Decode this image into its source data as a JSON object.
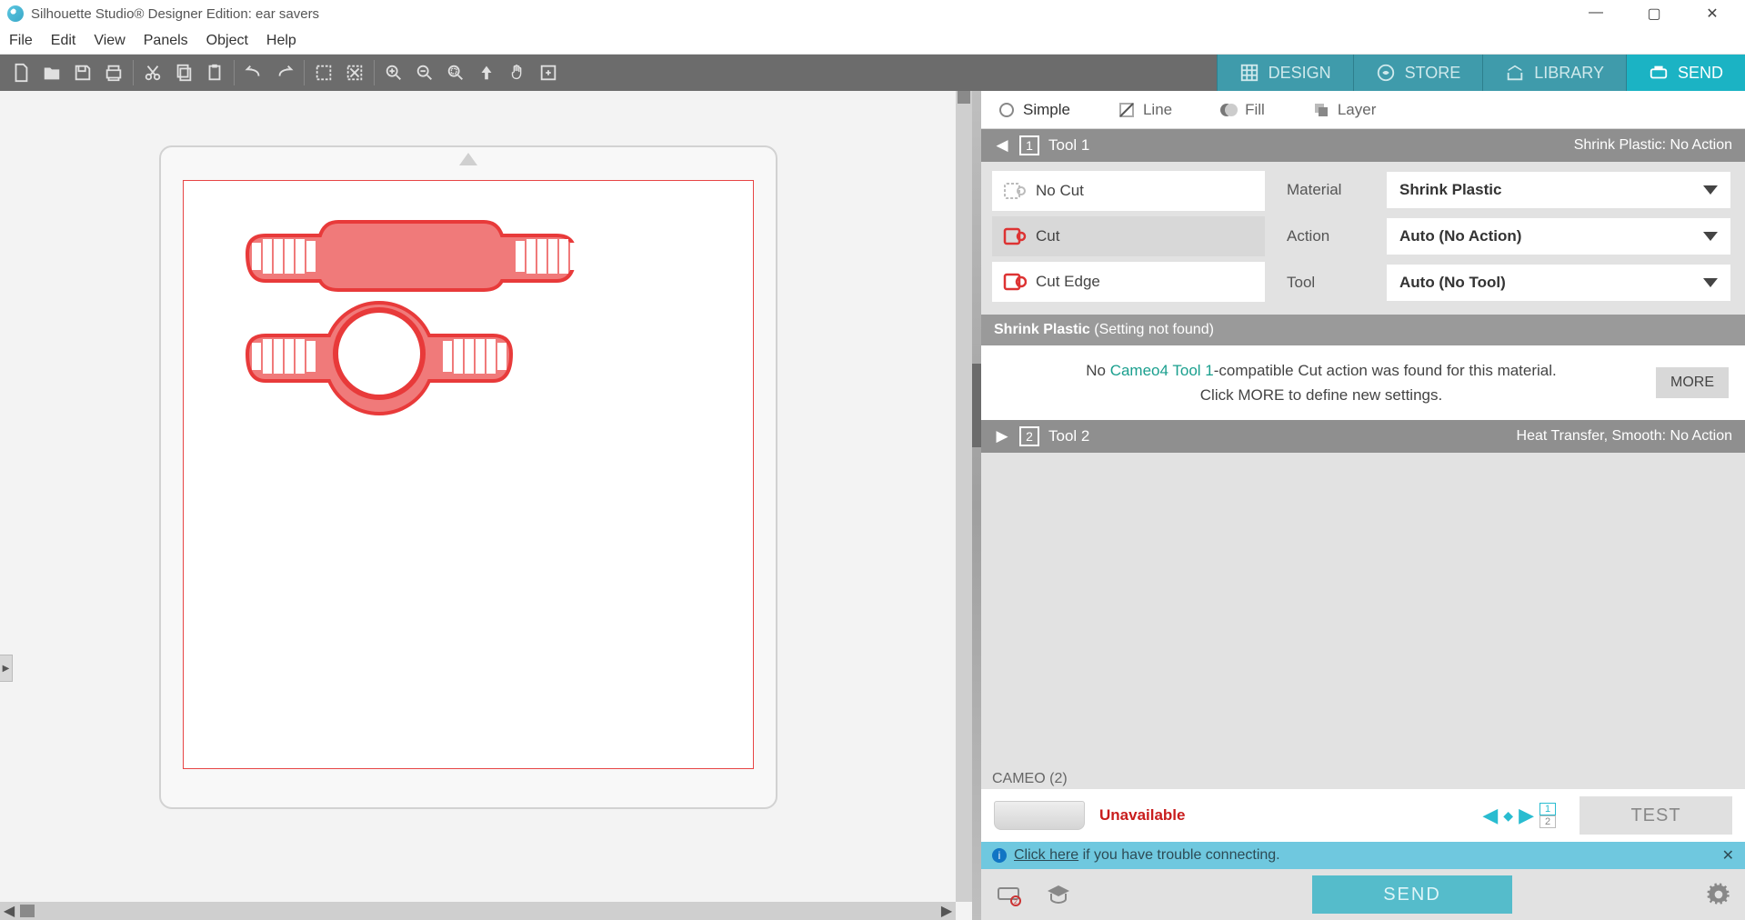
{
  "titlebar": {
    "app_title": "Silhouette Studio® Designer Edition: ear savers",
    "minimize": "—",
    "maximize": "▢",
    "close": "✕"
  },
  "menubar": [
    "File",
    "Edit",
    "View",
    "Panels",
    "Object",
    "Help"
  ],
  "maintabs": {
    "design": "DESIGN",
    "store": "STORE",
    "library": "LIBRARY",
    "send": "SEND"
  },
  "subtabs": {
    "simple": "Simple",
    "line": "Line",
    "fill": "Fill",
    "layer": "Layer"
  },
  "tool1": {
    "header_label": "Tool 1",
    "header_num": "1",
    "right_label": "Shrink Plastic: No Action",
    "options": {
      "nocut": "No Cut",
      "cut": "Cut",
      "cutedge": "Cut Edge"
    },
    "labels": {
      "material": "Material",
      "action": "Action",
      "tool": "Tool"
    },
    "values": {
      "material": "Shrink Plastic",
      "action": "Auto (No Action)",
      "tool": "Auto (No Tool)"
    },
    "banner_bold": "Shrink Plastic",
    "banner_rest": " (Setting not found)",
    "info_pre": "No ",
    "info_green": "Cameo4 Tool 1",
    "info_post": "-compatible Cut action was found for this material.",
    "info_line2": "Click MORE to define new settings.",
    "more": "MORE"
  },
  "tool2": {
    "header_label": "Tool 2",
    "header_num": "2",
    "right_label": "Heat Transfer, Smooth: No Action"
  },
  "machine": {
    "name": "CAMEO (2)",
    "status": "Unavailable",
    "n1": "1",
    "n2": "2",
    "test": "TEST"
  },
  "helpbar": {
    "link": "Click here",
    "rest": " if you have trouble connecting.",
    "close": "✕"
  },
  "bottom": {
    "send": "SEND"
  }
}
